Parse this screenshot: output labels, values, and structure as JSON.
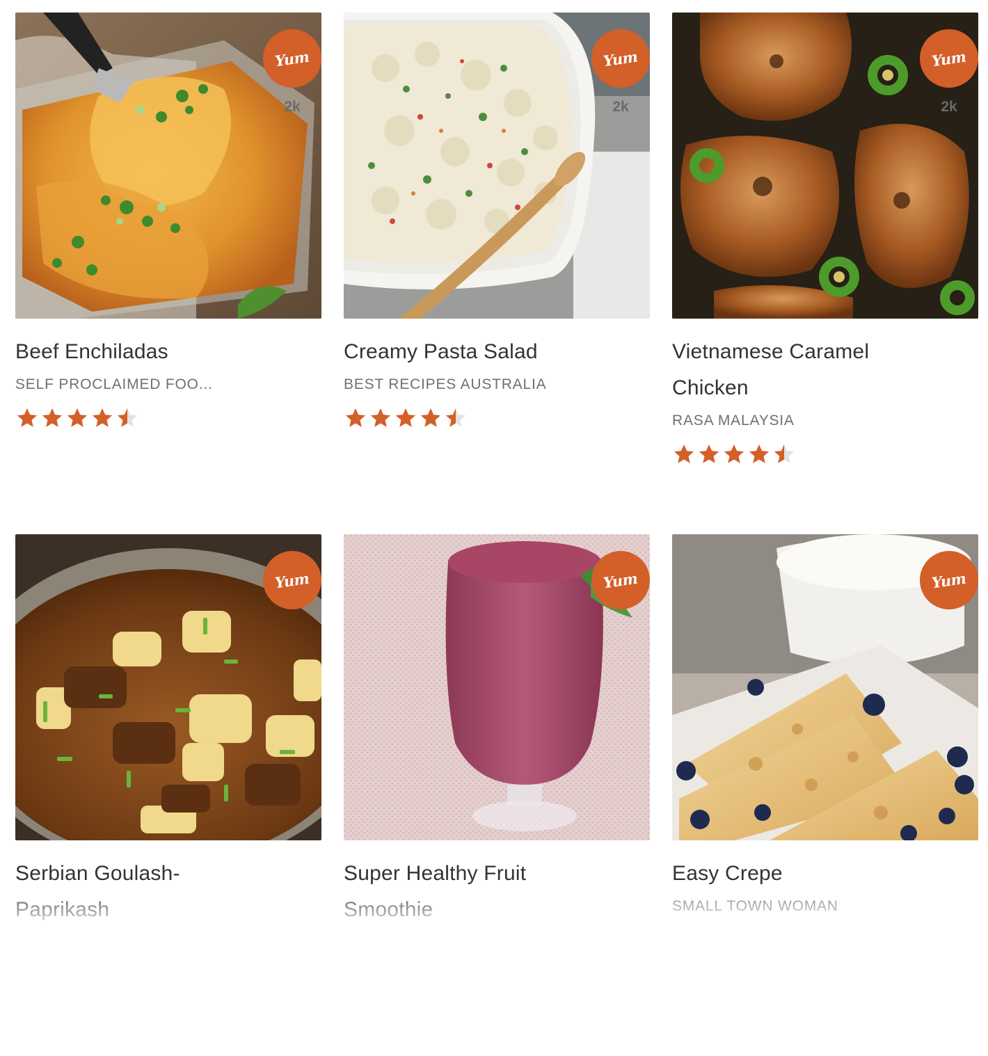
{
  "colors": {
    "accent": "#d35f29",
    "star_filled": "#d35f29",
    "star_empty": "#e2e2e2",
    "title_text": "#333333",
    "source_text": "#707070"
  },
  "recipes": [
    {
      "title": "Beef Enchiladas",
      "source": "SELF PROCLAIMED FOO...",
      "rating": 4.5,
      "yum_label": "Yum",
      "yum_count": "2k",
      "image": "beef-enchiladas-photo"
    },
    {
      "title": "Creamy Pasta Salad",
      "source": "BEST RECIPES AUSTRALIA",
      "rating": 4.5,
      "yum_label": "Yum",
      "yum_count": "2k",
      "image": "creamy-pasta-salad-photo"
    },
    {
      "title": "Vietnamese Caramel Chicken",
      "source": "RASA MALAYSIA",
      "rating": 4.5,
      "yum_label": "Yum",
      "yum_count": "2k",
      "image": "vietnamese-caramel-chicken-photo"
    },
    {
      "title": "Serbian Goulash-Paprikash",
      "yum_label": "Yum",
      "image": "serbian-goulash-photo"
    },
    {
      "title": "Super Healthy Fruit Smoothie",
      "yum_label": "Yum",
      "image": "fruit-smoothie-photo"
    },
    {
      "title": "Easy Crepe",
      "source": "SMALL TOWN WOMAN",
      "yum_label": "Yum",
      "image": "easy-crepe-photo"
    }
  ]
}
